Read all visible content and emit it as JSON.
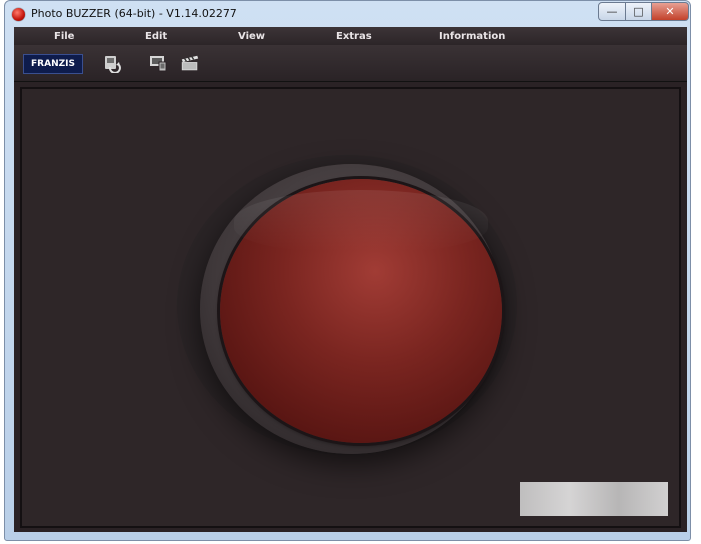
{
  "window": {
    "title": "Photo BUZZER (64-bit) - V1.14.02277",
    "controls": {
      "minimize": "—",
      "maximize": "□",
      "close": "✕"
    }
  },
  "menu": {
    "items": [
      "File",
      "Edit",
      "View",
      "Extras",
      "Information"
    ]
  },
  "toolbar": {
    "logo": "FRANZIS",
    "tools": [
      {
        "icon": "camera-sync-icon"
      },
      {
        "icon": "devices-icon"
      },
      {
        "icon": "clapperboard-icon"
      }
    ]
  },
  "colors": {
    "buzzer_red": "#7a2520",
    "background": "#2a2225"
  }
}
